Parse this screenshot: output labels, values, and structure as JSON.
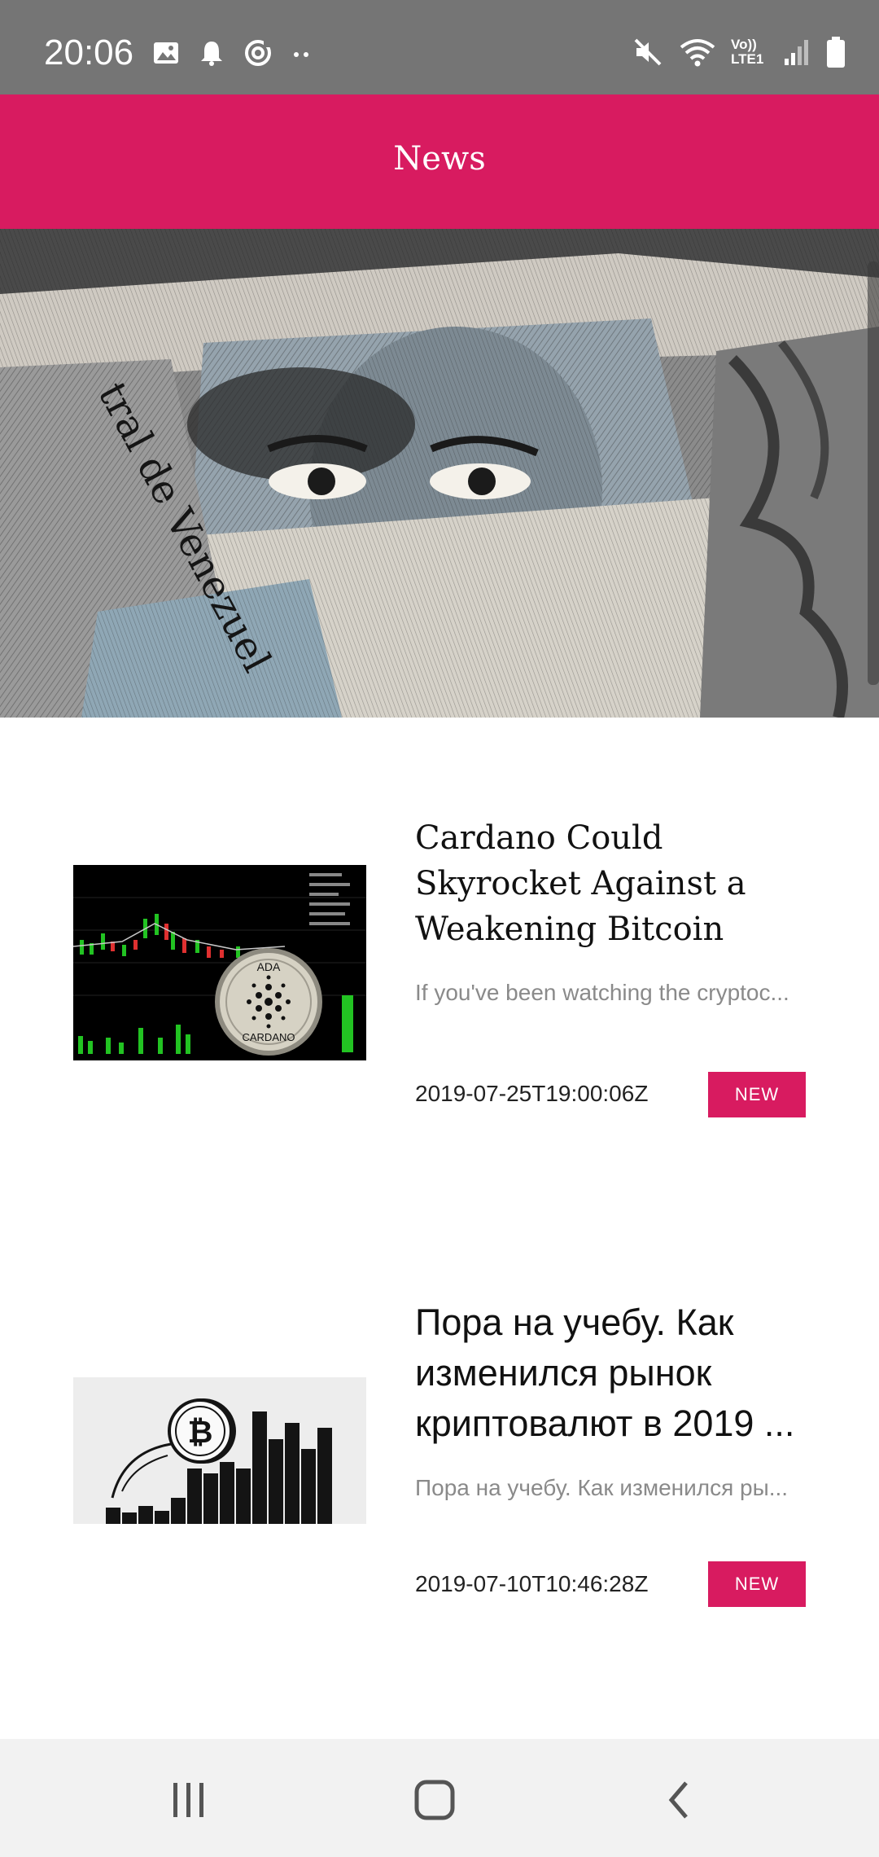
{
  "status_bar": {
    "time": "20:06",
    "left_icons": [
      "image-icon",
      "bell-icon",
      "sync-icon",
      "more-dots-icon"
    ],
    "right_icons": [
      "mute-icon",
      "wifi-icon",
      "volte-icon",
      "signal-icon",
      "battery-icon"
    ],
    "volte_label": "Vo)) LTE1"
  },
  "app_bar": {
    "title": "News"
  },
  "colors": {
    "accent": "#d81b60",
    "status_bar": "#757575",
    "nav_bar": "#f2f2f2"
  },
  "articles": [
    {
      "title": "Cardano Could Skyrocket Against a Weakening Bitcoin",
      "snippet": "If you've been watching the cryptoc...",
      "date": "2019-07-25T19:00:06Z",
      "badge": "NEW",
      "thumb_text_top": "ADA",
      "thumb_text_bottom": "CARDANO"
    },
    {
      "title": "Пора на учебу. Как изменился рынок криптовалют в 2019 ...",
      "snippet": "Пора на учебу. Как изменился ры...",
      "date": "2019-07-10T10:46:28Z",
      "badge": "NEW"
    }
  ],
  "nav_bar": {
    "icons": [
      "recent-apps-icon",
      "home-icon",
      "back-icon"
    ]
  }
}
